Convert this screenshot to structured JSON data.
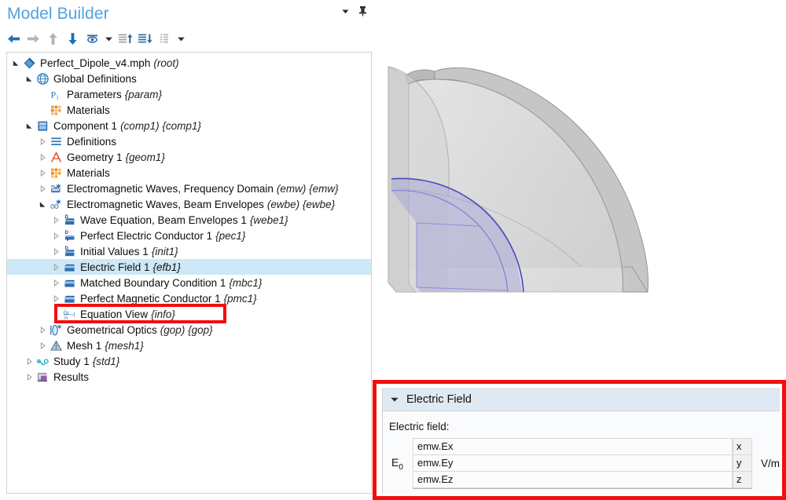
{
  "window": {
    "title": "Model Builder",
    "accent_color": "#4ea3e0",
    "selection_color": "#cde8f6",
    "annotation_color": "#f10f0f"
  },
  "title_actions": [
    {
      "name": "collapse-dropdown-icon",
      "glyph": "▼"
    },
    {
      "name": "pin-icon",
      "glyph": "pin"
    }
  ],
  "toolbar": {
    "buttons": [
      {
        "name": "back-button",
        "icon": "arrow-left-icon",
        "label": "Back"
      },
      {
        "name": "forward-button",
        "icon": "arrow-right-icon",
        "label": "Forward"
      },
      {
        "name": "move-up-button",
        "icon": "arrow-up-icon",
        "label": "Move Up"
      },
      {
        "name": "move-down-button",
        "icon": "arrow-down-icon",
        "label": "Move Down"
      },
      {
        "name": "show-button",
        "icon": "eye-icon",
        "label": "Show"
      },
      {
        "name": "show-dropdown-button",
        "icon": "chevron-down-icon",
        "label": "Show options"
      },
      {
        "name": "collapse-all-button",
        "icon": "list-collapse-icon",
        "label": "Collapse All"
      },
      {
        "name": "expand-all-button",
        "icon": "list-expand-icon",
        "label": "Expand All"
      },
      {
        "name": "list-view-button",
        "icon": "list-icon",
        "label": "List"
      },
      {
        "name": "list-dropdown-button",
        "icon": "chevron-down-icon",
        "label": "List options"
      }
    ]
  },
  "tree": {
    "selected_node": "Electric Field 1",
    "nodes": [
      {
        "depth": 0,
        "twisty": "expanded",
        "icon": "model-root-icon",
        "label": "Perfect_Dipole_v4.mph",
        "tag": "(root)"
      },
      {
        "depth": 1,
        "twisty": "expanded",
        "icon": "globe-icon",
        "label": "Global Definitions",
        "tag": ""
      },
      {
        "depth": 2,
        "twisty": "none",
        "icon": "parameters-icon",
        "label": "Parameters",
        "tag": "{param}"
      },
      {
        "depth": 2,
        "twisty": "none",
        "icon": "materials-icon",
        "label": "Materials",
        "tag": ""
      },
      {
        "depth": 1,
        "twisty": "expanded",
        "icon": "component-icon",
        "label": "Component 1",
        "tag": "(comp1) {comp1}"
      },
      {
        "depth": 2,
        "twisty": "collapsed",
        "icon": "definitions-icon",
        "label": "Definitions",
        "tag": ""
      },
      {
        "depth": 2,
        "twisty": "collapsed",
        "icon": "geometry-icon",
        "label": "Geometry 1",
        "tag": "{geom1}"
      },
      {
        "depth": 2,
        "twisty": "collapsed",
        "icon": "materials-icon",
        "label": "Materials",
        "tag": ""
      },
      {
        "depth": 2,
        "twisty": "collapsed",
        "icon": "emw-fd-icon",
        "label": "Electromagnetic Waves, Frequency Domain",
        "tag": "(emw) {emw}"
      },
      {
        "depth": 2,
        "twisty": "expanded",
        "icon": "emw-be-icon",
        "label": "Electromagnetic Waves, Beam Envelopes",
        "tag": "(ewbe) {ewbe}"
      },
      {
        "depth": 3,
        "twisty": "collapsed",
        "icon": "domain-node-icon",
        "label": "Wave Equation, Beam Envelopes 1",
        "tag": "{webe1}"
      },
      {
        "depth": 3,
        "twisty": "collapsed",
        "icon": "pec-node-icon",
        "label": "Perfect Electric Conductor 1",
        "tag": "{pec1}"
      },
      {
        "depth": 3,
        "twisty": "collapsed",
        "icon": "domain-node-icon",
        "label": "Initial Values 1",
        "tag": "{init1}"
      },
      {
        "depth": 3,
        "twisty": "collapsed",
        "icon": "boundary-node-icon",
        "label": "Electric Field 1",
        "tag": "{efb1}",
        "selected": true
      },
      {
        "depth": 3,
        "twisty": "collapsed",
        "icon": "boundary-node-icon",
        "label": "Matched Boundary Condition 1",
        "tag": "{mbc1}"
      },
      {
        "depth": 3,
        "twisty": "collapsed",
        "icon": "boundary-node-icon",
        "label": "Perfect Magnetic Conductor 1",
        "tag": "{pmc1}"
      },
      {
        "depth": 3,
        "twisty": "none",
        "icon": "equation-view-icon",
        "label": "Equation View",
        "tag": "{info}"
      },
      {
        "depth": 2,
        "twisty": "collapsed",
        "icon": "optics-icon",
        "label": "Geometrical Optics",
        "tag": "(gop) {gop}"
      },
      {
        "depth": 2,
        "twisty": "collapsed",
        "icon": "mesh-icon",
        "label": "Mesh 1",
        "tag": "{mesh1}"
      },
      {
        "depth": 1,
        "twisty": "collapsed",
        "icon": "study-icon",
        "label": "Study 1",
        "tag": "{std1}"
      },
      {
        "depth": 1,
        "twisty": "collapsed",
        "icon": "results-icon",
        "label": "Results",
        "tag": ""
      }
    ]
  },
  "graphics": {
    "name": "3d-geometry-view",
    "description": "quarter-sphere shell geometry with highlighted inner spherical boundary",
    "outer_color": "#c9c9c9",
    "highlight_color": "#9a9ad8"
  },
  "settings": {
    "section_title": "Electric Field",
    "caret": "▼",
    "field_label": "Electric field:",
    "subscript_label_main": "E",
    "subscript_label_sub": "0",
    "unit": "V/m",
    "components": [
      {
        "value": "emw.Ex",
        "axis": "x"
      },
      {
        "value": "emw.Ey",
        "axis": "y"
      },
      {
        "value": "emw.Ez",
        "axis": "z"
      }
    ]
  }
}
